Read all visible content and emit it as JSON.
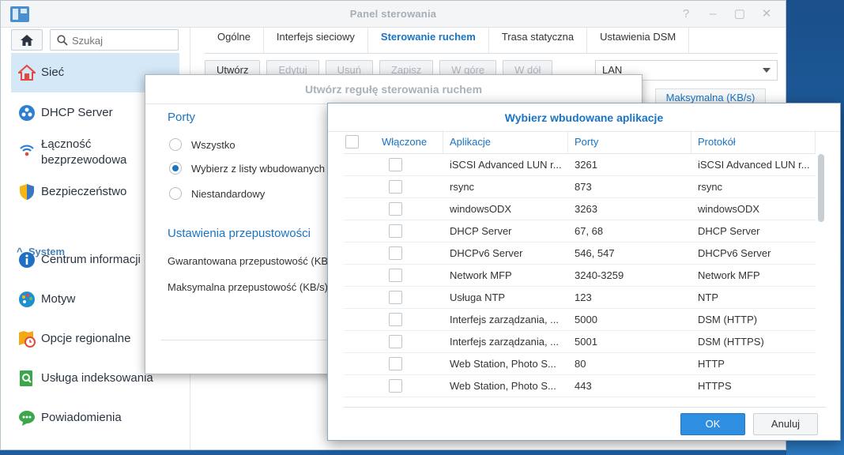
{
  "window": {
    "title": "Panel sterowania",
    "controls": [
      "?",
      "–",
      "▢",
      "✕"
    ]
  },
  "search": {
    "placeholder": "Szukaj"
  },
  "sidebar": {
    "items": [
      {
        "label": "Sieć",
        "icon": "network-home-icon"
      },
      {
        "label": "DHCP Server",
        "icon": "dhcp-icon"
      },
      {
        "label": "Łączność",
        "label2": "bezprzewodowa",
        "icon": "wifi-icon"
      },
      {
        "label": "Bezpieczeństwo",
        "icon": "shield-icon"
      },
      {
        "label": "Centrum informacji",
        "icon": "info-icon"
      },
      {
        "label": "Motyw",
        "icon": "palette-icon"
      },
      {
        "label": "Opcje regionalne",
        "icon": "clock-map-icon"
      },
      {
        "label": "Usługa indeksowania",
        "icon": "index-search-icon"
      },
      {
        "label": "Powiadomienia",
        "icon": "chat-bubble-icon"
      }
    ],
    "section": "System"
  },
  "tabs": [
    "Ogólne",
    "Interfejs sieciowy",
    "Sterowanie ruchem",
    "Trasa statyczna",
    "Ustawienia DSM"
  ],
  "toolbar": {
    "buttons": [
      "Utwórz",
      "Edytuj",
      "Usuń",
      "Zapisz",
      "W górę",
      "W dół"
    ],
    "interface_select": "LAN",
    "column_header": "Maksymalna (KB/s)"
  },
  "dialog1": {
    "title": "Utwórz regułę sterowania ruchem",
    "ports_section": "Porty",
    "radio_options": [
      "Wszystko",
      "Wybierz z listy wbudowanych",
      "Niestandardowy"
    ],
    "selected_radio": 1,
    "bandwidth_section": "Ustawienia przepustowości",
    "guaranteed_label": "Gwarantowana przepustowość (KB/s)",
    "max_label": "Maksymalna przepustowość (KB/s)"
  },
  "dialog2": {
    "title": "Wybierz wbudowane aplikacje",
    "columns": [
      "Włączone",
      "Aplikacje",
      "Porty",
      "Protokół"
    ],
    "rows": [
      {
        "app": "iSCSI Advanced LUN r...",
        "ports": "3261",
        "protocol": "iSCSI Advanced LUN r..."
      },
      {
        "app": "rsync",
        "ports": "873",
        "protocol": "rsync"
      },
      {
        "app": "windowsODX",
        "ports": "3263",
        "protocol": "windowsODX"
      },
      {
        "app": "DHCP Server",
        "ports": "67, 68",
        "protocol": "DHCP Server"
      },
      {
        "app": "DHCPv6 Server",
        "ports": "546, 547",
        "protocol": "DHCPv6 Server"
      },
      {
        "app": "Network MFP",
        "ports": "3240-3259",
        "protocol": "Network MFP"
      },
      {
        "app": "Usługa NTP",
        "ports": "123",
        "protocol": "NTP"
      },
      {
        "app": "Interfejs zarządzania, ...",
        "ports": "5000",
        "protocol": "DSM (HTTP)"
      },
      {
        "app": "Interfejs zarządzania, ...",
        "ports": "5001",
        "protocol": "DSM (HTTPS)"
      },
      {
        "app": "Web Station, Photo S...",
        "ports": "80",
        "protocol": "HTTP"
      },
      {
        "app": "Web Station, Photo S...",
        "ports": "443",
        "protocol": "HTTPS"
      }
    ],
    "ok_label": "OK",
    "cancel_label": "Anuluj"
  }
}
